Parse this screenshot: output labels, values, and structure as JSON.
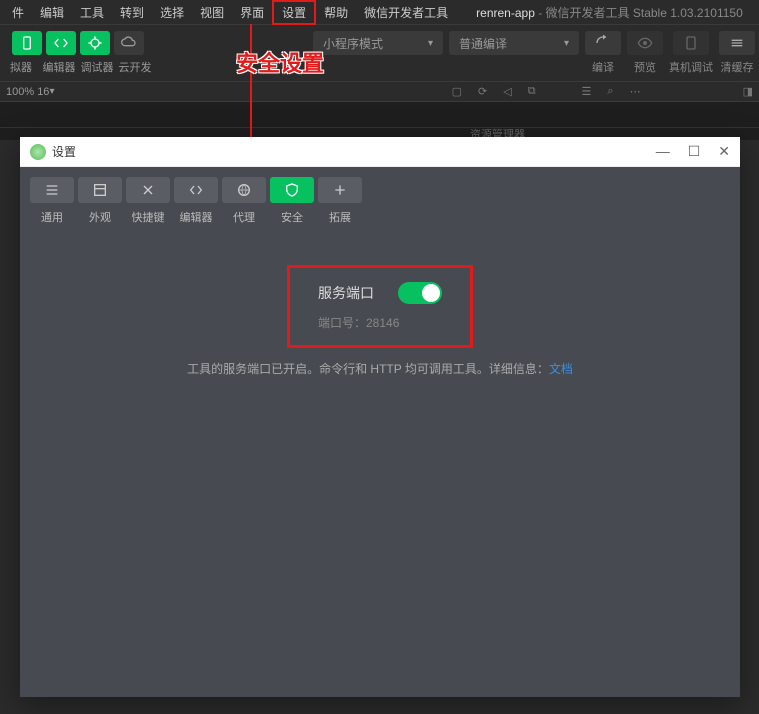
{
  "menubar": {
    "items": [
      "件",
      "编辑",
      "工具",
      "转到",
      "选择",
      "视图",
      "界面",
      "设置",
      "帮助",
      "微信开发者工具"
    ],
    "app_name": "renren-app",
    "app_suffix": " - 微信开发者工具 Stable 1.03.2101150"
  },
  "toolbar": {
    "left_labels": [
      "拟器",
      "编辑器",
      "调试器",
      "云开发"
    ],
    "mode_label": "小程序模式",
    "compile_label": "普通编译",
    "right": [
      {
        "label": "编译"
      },
      {
        "label": "预览"
      },
      {
        "label": "真机调试"
      },
      {
        "label": "清缓存"
      }
    ]
  },
  "statusbar": {
    "zoom": "100% 16"
  },
  "panel": {
    "label": "资源管理器"
  },
  "annotation": {
    "text": "安全设置"
  },
  "modal": {
    "title": "设置",
    "tabs": [
      {
        "label": "通用"
      },
      {
        "label": "外观"
      },
      {
        "label": "快捷键"
      },
      {
        "label": "编辑器"
      },
      {
        "label": "代理"
      },
      {
        "label": "安全"
      },
      {
        "label": "拓展"
      }
    ],
    "port": {
      "label": "服务端口",
      "info": "端口号：28146",
      "desc_prefix": "工具的服务端口已开启。命令行和 HTTP 均可调用工具。详细信息：",
      "desc_link": "文档"
    }
  }
}
